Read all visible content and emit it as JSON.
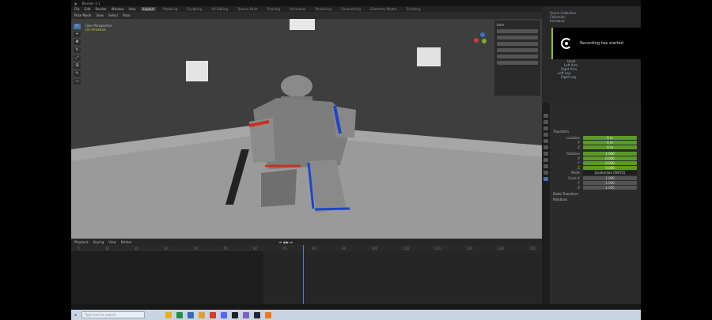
{
  "window": {
    "title": "Blender 4.1"
  },
  "menu": [
    "File",
    "Edit",
    "Render",
    "Window",
    "Help"
  ],
  "workspaces": [
    {
      "label": "Layout",
      "active": true
    },
    {
      "label": "Modeling"
    },
    {
      "label": "Sculpting"
    },
    {
      "label": "UV Editing"
    },
    {
      "label": "Texture Paint"
    },
    {
      "label": "Shading"
    },
    {
      "label": "Animation"
    },
    {
      "label": "Rendering"
    },
    {
      "label": "Compositing"
    },
    {
      "label": "Geometry Nodes"
    },
    {
      "label": "Scripting"
    }
  ],
  "viewport_header": {
    "mode": "Pose Mode",
    "items": [
      "View",
      "Select",
      "Pose"
    ]
  },
  "viewport_info": {
    "view": "User Perspective",
    "object": "(0) Armature"
  },
  "npanel": {
    "title": "Item",
    "buttons": [
      "",
      "",
      "",
      "",
      "",
      ""
    ]
  },
  "timeline": {
    "menus": [
      "Playback",
      "Keying",
      "View",
      "Marker"
    ],
    "ticks": [
      "0",
      "10",
      "20",
      "30",
      "40",
      "50",
      "60",
      "70",
      "80",
      "90",
      "100",
      "110",
      "120",
      "130",
      "140",
      "150"
    ]
  },
  "notification": {
    "text": "Recording has started"
  },
  "outliner": {
    "rows": [
      "Scene Collection",
      "Collection",
      "Armature",
      "Pose",
      "Torso",
      "Head",
      "Left Arm",
      "Right Arm",
      "Left Leg",
      "Right Leg"
    ]
  },
  "properties": {
    "section": "Transform",
    "rows": [
      {
        "label": "Location",
        "value": "0 m",
        "green": true
      },
      {
        "label": "Y",
        "value": "0 m",
        "green": true
      },
      {
        "label": "Z",
        "value": "0 m",
        "green": true
      },
      {
        "label": "Rotation",
        "value": "1.000",
        "green": true
      },
      {
        "label": "X",
        "value": "0.000",
        "green": true
      },
      {
        "label": "Y",
        "value": "0.000",
        "green": true
      },
      {
        "label": "Z",
        "value": "0.000",
        "green": true
      },
      {
        "label": "Mode",
        "value": "Quaternion (WXYZ)",
        "green": false
      },
      {
        "label": "Scale X",
        "value": "1.000",
        "green": false
      },
      {
        "label": "Y",
        "value": "1.000",
        "green": false
      },
      {
        "label": "Z",
        "value": "1.000",
        "green": false
      }
    ],
    "sections2": [
      "Delta Transform",
      "Relations"
    ]
  },
  "taskbar": {
    "search_placeholder": "Type here to search"
  },
  "colors": {
    "accent": "#4772b3",
    "keyed": "#5c9a28",
    "armor_red": "#c8321e",
    "armor_blue": "#1e46c8"
  }
}
